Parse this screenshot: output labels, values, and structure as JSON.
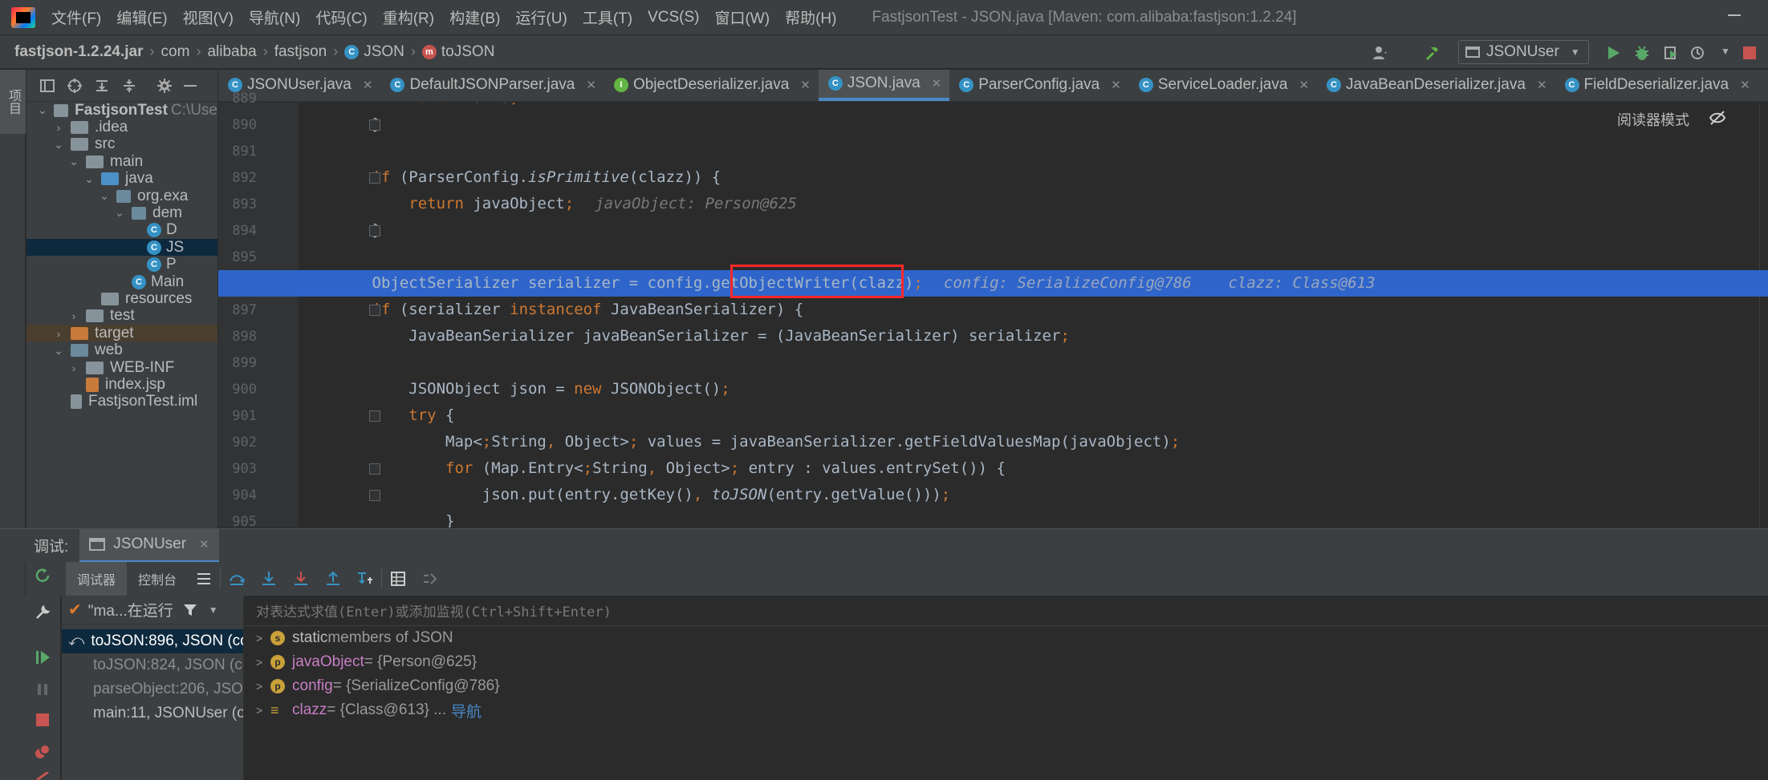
{
  "menubar": {
    "items": [
      "文件(F)",
      "编辑(E)",
      "视图(V)",
      "导航(N)",
      "代码(C)",
      "重构(R)",
      "构建(B)",
      "运行(U)",
      "工具(T)",
      "VCS(S)",
      "窗口(W)",
      "帮助(H)"
    ],
    "window_title": "FastjsonTest - JSON.java [Maven: com.alibaba:fastjson:1.2.24]"
  },
  "breadcrumb": {
    "items": [
      "fastjson-1.2.24.jar",
      "com",
      "alibaba",
      "fastjson",
      "JSON",
      "toJSON"
    ]
  },
  "toolbar": {
    "run_config": "JSONUser"
  },
  "project_panel": {
    "tab_label": "项目",
    "rows": [
      {
        "label": "FastjsonTest",
        "extra": "C:\\Use",
        "indent": 0,
        "arrow": "open",
        "icon": "module"
      },
      {
        "label": ".idea",
        "indent": 1,
        "arrow": "closed",
        "icon": "folder"
      },
      {
        "label": "src",
        "indent": 1,
        "arrow": "open",
        "icon": "folder"
      },
      {
        "label": "main",
        "indent": 2,
        "arrow": "open",
        "icon": "folder"
      },
      {
        "label": "java",
        "indent": 3,
        "arrow": "open",
        "icon": "folder-blue"
      },
      {
        "label": "org.exa",
        "indent": 4,
        "arrow": "open",
        "icon": "package"
      },
      {
        "label": "dem",
        "indent": 5,
        "arrow": "open",
        "icon": "package"
      },
      {
        "label": "D",
        "indent": 6,
        "arrow": "",
        "icon": "class"
      },
      {
        "label": "JS",
        "indent": 6,
        "arrow": "",
        "icon": "class"
      },
      {
        "label": "P",
        "indent": 6,
        "arrow": "",
        "icon": "class"
      },
      {
        "label": "Main",
        "indent": 5,
        "arrow": "",
        "icon": "class"
      },
      {
        "label": "resources",
        "indent": 3,
        "arrow": "",
        "icon": "folder"
      },
      {
        "label": "test",
        "indent": 2,
        "arrow": "closed",
        "icon": "folder"
      },
      {
        "label": "target",
        "indent": 1,
        "arrow": "closed",
        "icon": "folder-orange"
      },
      {
        "label": "web",
        "indent": 1,
        "arrow": "open",
        "icon": "folder-teal"
      },
      {
        "label": "WEB-INF",
        "indent": 2,
        "arrow": "closed",
        "icon": "folder"
      },
      {
        "label": "index.jsp",
        "indent": 2,
        "arrow": "",
        "icon": "jsp"
      },
      {
        "label": "FastjsonTest.iml",
        "indent": 1,
        "arrow": "",
        "icon": "file"
      }
    ]
  },
  "editor": {
    "tabs": [
      {
        "label": "JSONUser.java",
        "icon": "C",
        "color": "blue"
      },
      {
        "label": "DefaultJSONParser.java",
        "icon": "C",
        "color": "blue"
      },
      {
        "label": "ObjectDeserializer.java",
        "icon": "I",
        "color": "green"
      },
      {
        "label": "JSON.java",
        "icon": "C",
        "color": "blue",
        "active": true
      },
      {
        "label": "ParserConfig.java",
        "icon": "C",
        "color": "blue"
      },
      {
        "label": "ServiceLoader.java",
        "icon": "C",
        "color": "blue"
      },
      {
        "label": "JavaBeanDeserializer.java",
        "icon": "C",
        "color": "blue"
      },
      {
        "label": "FieldDeserializer.java",
        "icon": "C",
        "color": "blue"
      }
    ],
    "reader_mode": "阅读器模式",
    "lines": [
      {
        "n": "889",
        "text": "            return arra;"
      },
      {
        "n": "890",
        "text": "        }"
      },
      {
        "n": "891",
        "text": ""
      },
      {
        "n": "892",
        "text": "        if (ParserConfig.isPrimitive(clazz)) {"
      },
      {
        "n": "893",
        "text": "            return javaObject;",
        "hint": "javaObject: Person@625"
      },
      {
        "n": "894",
        "text": "        }"
      },
      {
        "n": "895",
        "text": ""
      },
      {
        "n": "896",
        "text": "        ObjectSerializer serializer = config.getObjectWriter(clazz);",
        "hint": "config: SerializeConfig@786    clazz: Class@613"
      },
      {
        "n": "897",
        "text": "        if (serializer instanceof JavaBeanSerializer) {"
      },
      {
        "n": "898",
        "text": "            JavaBeanSerializer javaBeanSerializer = (JavaBeanSerializer) serializer;"
      },
      {
        "n": "899",
        "text": ""
      },
      {
        "n": "900",
        "text": "            JSONObject json = new JSONObject();"
      },
      {
        "n": "901",
        "text": "            try {"
      },
      {
        "n": "902",
        "text": "                Map<String, Object> values = javaBeanSerializer.getFieldValuesMap(javaObject);"
      },
      {
        "n": "903",
        "text": "                for (Map.Entry<String, Object> entry : values.entrySet()) {"
      },
      {
        "n": "904",
        "text": "                    json.put(entry.getKey(), toJSON(entry.getValue()));"
      },
      {
        "n": "905",
        "text": "                }"
      }
    ]
  },
  "debug": {
    "label": "调试:",
    "session_tab": "JSONUser",
    "tabs": [
      "调试器",
      "控制台"
    ],
    "thread_status": "\"ma...在运行",
    "eval_placeholder": "对表达式求值(Enter)或添加监视(Ctrl+Shift+Enter)",
    "frames": [
      {
        "label": "toJSON:896, JSON (co",
        "selected": true
      },
      {
        "label": "toJSON:824, JSON (co",
        "dim": true
      },
      {
        "label": "parseObject:206, JSON",
        "dim": true
      },
      {
        "label": "main:11, JSONUser (o",
        "dim": false
      }
    ],
    "variables": [
      {
        "badge": "s",
        "name": "static",
        "rest": " members of JSON",
        "static": true
      },
      {
        "badge": "p",
        "name": "javaObject",
        "rest": " = {Person@625}"
      },
      {
        "badge": "p",
        "name": "config",
        "rest": " = {SerializeConfig@786}"
      },
      {
        "badge": "list",
        "name": "clazz",
        "rest": " = {Class@613} ... ",
        "link": "导航"
      }
    ]
  },
  "colors": {
    "highlight_line": "#2f65ca",
    "red_box": "#ff2828",
    "keyword": "#cc7832",
    "accent": "#4a88c7"
  }
}
